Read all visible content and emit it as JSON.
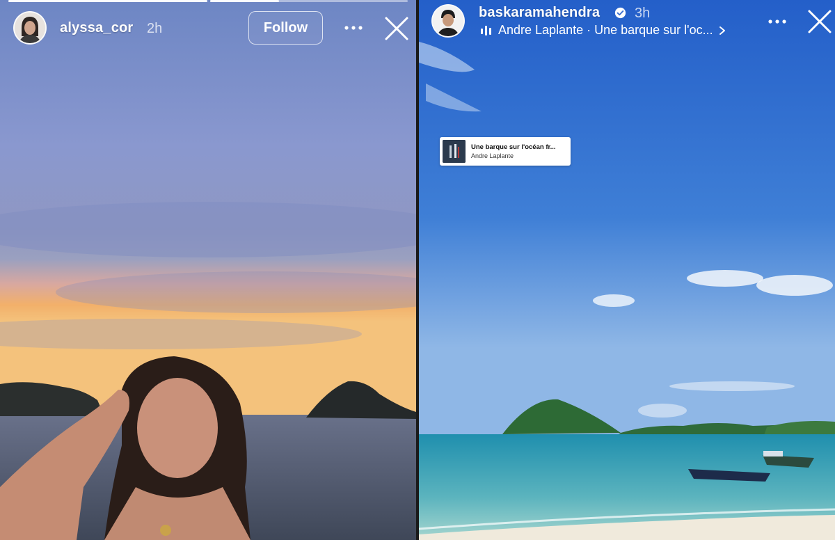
{
  "left_story": {
    "username": "alyssa_cor",
    "time": "2h",
    "follow_label": "Follow",
    "progress": [
      1.0,
      0.35
    ],
    "avatar_icon": "profile-photo",
    "more_icon": "more-horizontal-icon",
    "close_icon": "close-icon"
  },
  "right_story": {
    "username": "baskaramahendra",
    "time": "3h",
    "verified_icon": "verified-badge-icon",
    "music": {
      "text": "Andre Laplante · Une barque sur l'oc...",
      "icon": "audio-bars-icon",
      "chevron_icon": "chevron-right-icon"
    },
    "sticker": {
      "title": "Une barque sur l'océan fr...",
      "artist": "Andre Laplante"
    },
    "more_icon": "more-horizontal-icon",
    "close_icon": "close-icon"
  },
  "colors": {
    "sky_left_top": "#6f86c2",
    "sunset_glow": "#f2b06a",
    "sea_left": "#4c5668",
    "sky_right_top": "#2a63c9",
    "sea_right": "#2f9ab0",
    "sand": "#f0eadc"
  }
}
